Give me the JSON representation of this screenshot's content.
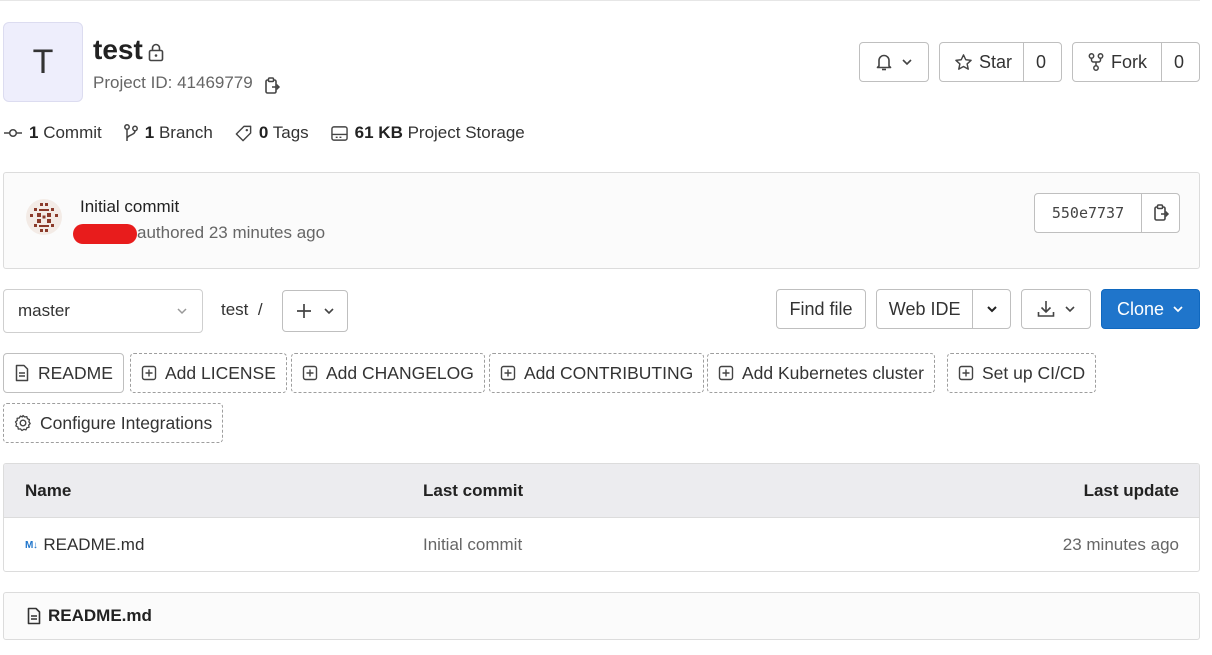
{
  "project": {
    "avatar_letter": "T",
    "name": "test",
    "id_text": "Project ID: 41469779"
  },
  "actions": {
    "star_label": "Star",
    "star_count": "0",
    "fork_label": "Fork",
    "fork_count": "0"
  },
  "stats": [
    {
      "count": "1",
      "label": "Commit",
      "icon": "commit-icon"
    },
    {
      "count": "1",
      "label": "Branch",
      "icon": "branch-icon"
    },
    {
      "count": "0",
      "label": "Tags",
      "icon": "tag-icon"
    },
    {
      "count": "61 KB",
      "label": "Project Storage",
      "icon": "storage-icon"
    }
  ],
  "commit": {
    "title": "Initial commit",
    "meta": "authored 23 minutes ago",
    "sha": "550e7737"
  },
  "toolbar": {
    "branch": "master",
    "breadcrumb": "test  /",
    "find_file": "Find file",
    "web_ide": "Web IDE",
    "clone": "Clone"
  },
  "suggestions": [
    {
      "label": "README",
      "style": "solid",
      "icon": "file-icon"
    },
    {
      "label": "Add LICENSE",
      "style": "dashed",
      "icon": "plus-square-icon"
    },
    {
      "label": "Add CHANGELOG",
      "style": "dashed",
      "icon": "plus-square-icon"
    },
    {
      "label": "Add CONTRIBUTING",
      "style": "dashed",
      "icon": "plus-square-icon"
    },
    {
      "label": "Add Kubernetes cluster",
      "style": "dashed",
      "icon": "plus-square-icon"
    },
    {
      "label": "Set up CI/CD",
      "style": "dashed",
      "icon": "plus-square-icon"
    },
    {
      "label": "Configure Integrations",
      "style": "dashed",
      "icon": "settings-icon"
    }
  ],
  "table": {
    "headers": {
      "name": "Name",
      "last_commit": "Last commit",
      "last_update": "Last update"
    },
    "rows": [
      {
        "icon_text": "M↓",
        "name": "README.md",
        "last_commit": "Initial commit",
        "last_update": "23 minutes ago"
      }
    ]
  },
  "readme": {
    "title": "README.md"
  },
  "colors": {
    "primary": "#1f75cb",
    "redaction": "#e81c1c"
  }
}
